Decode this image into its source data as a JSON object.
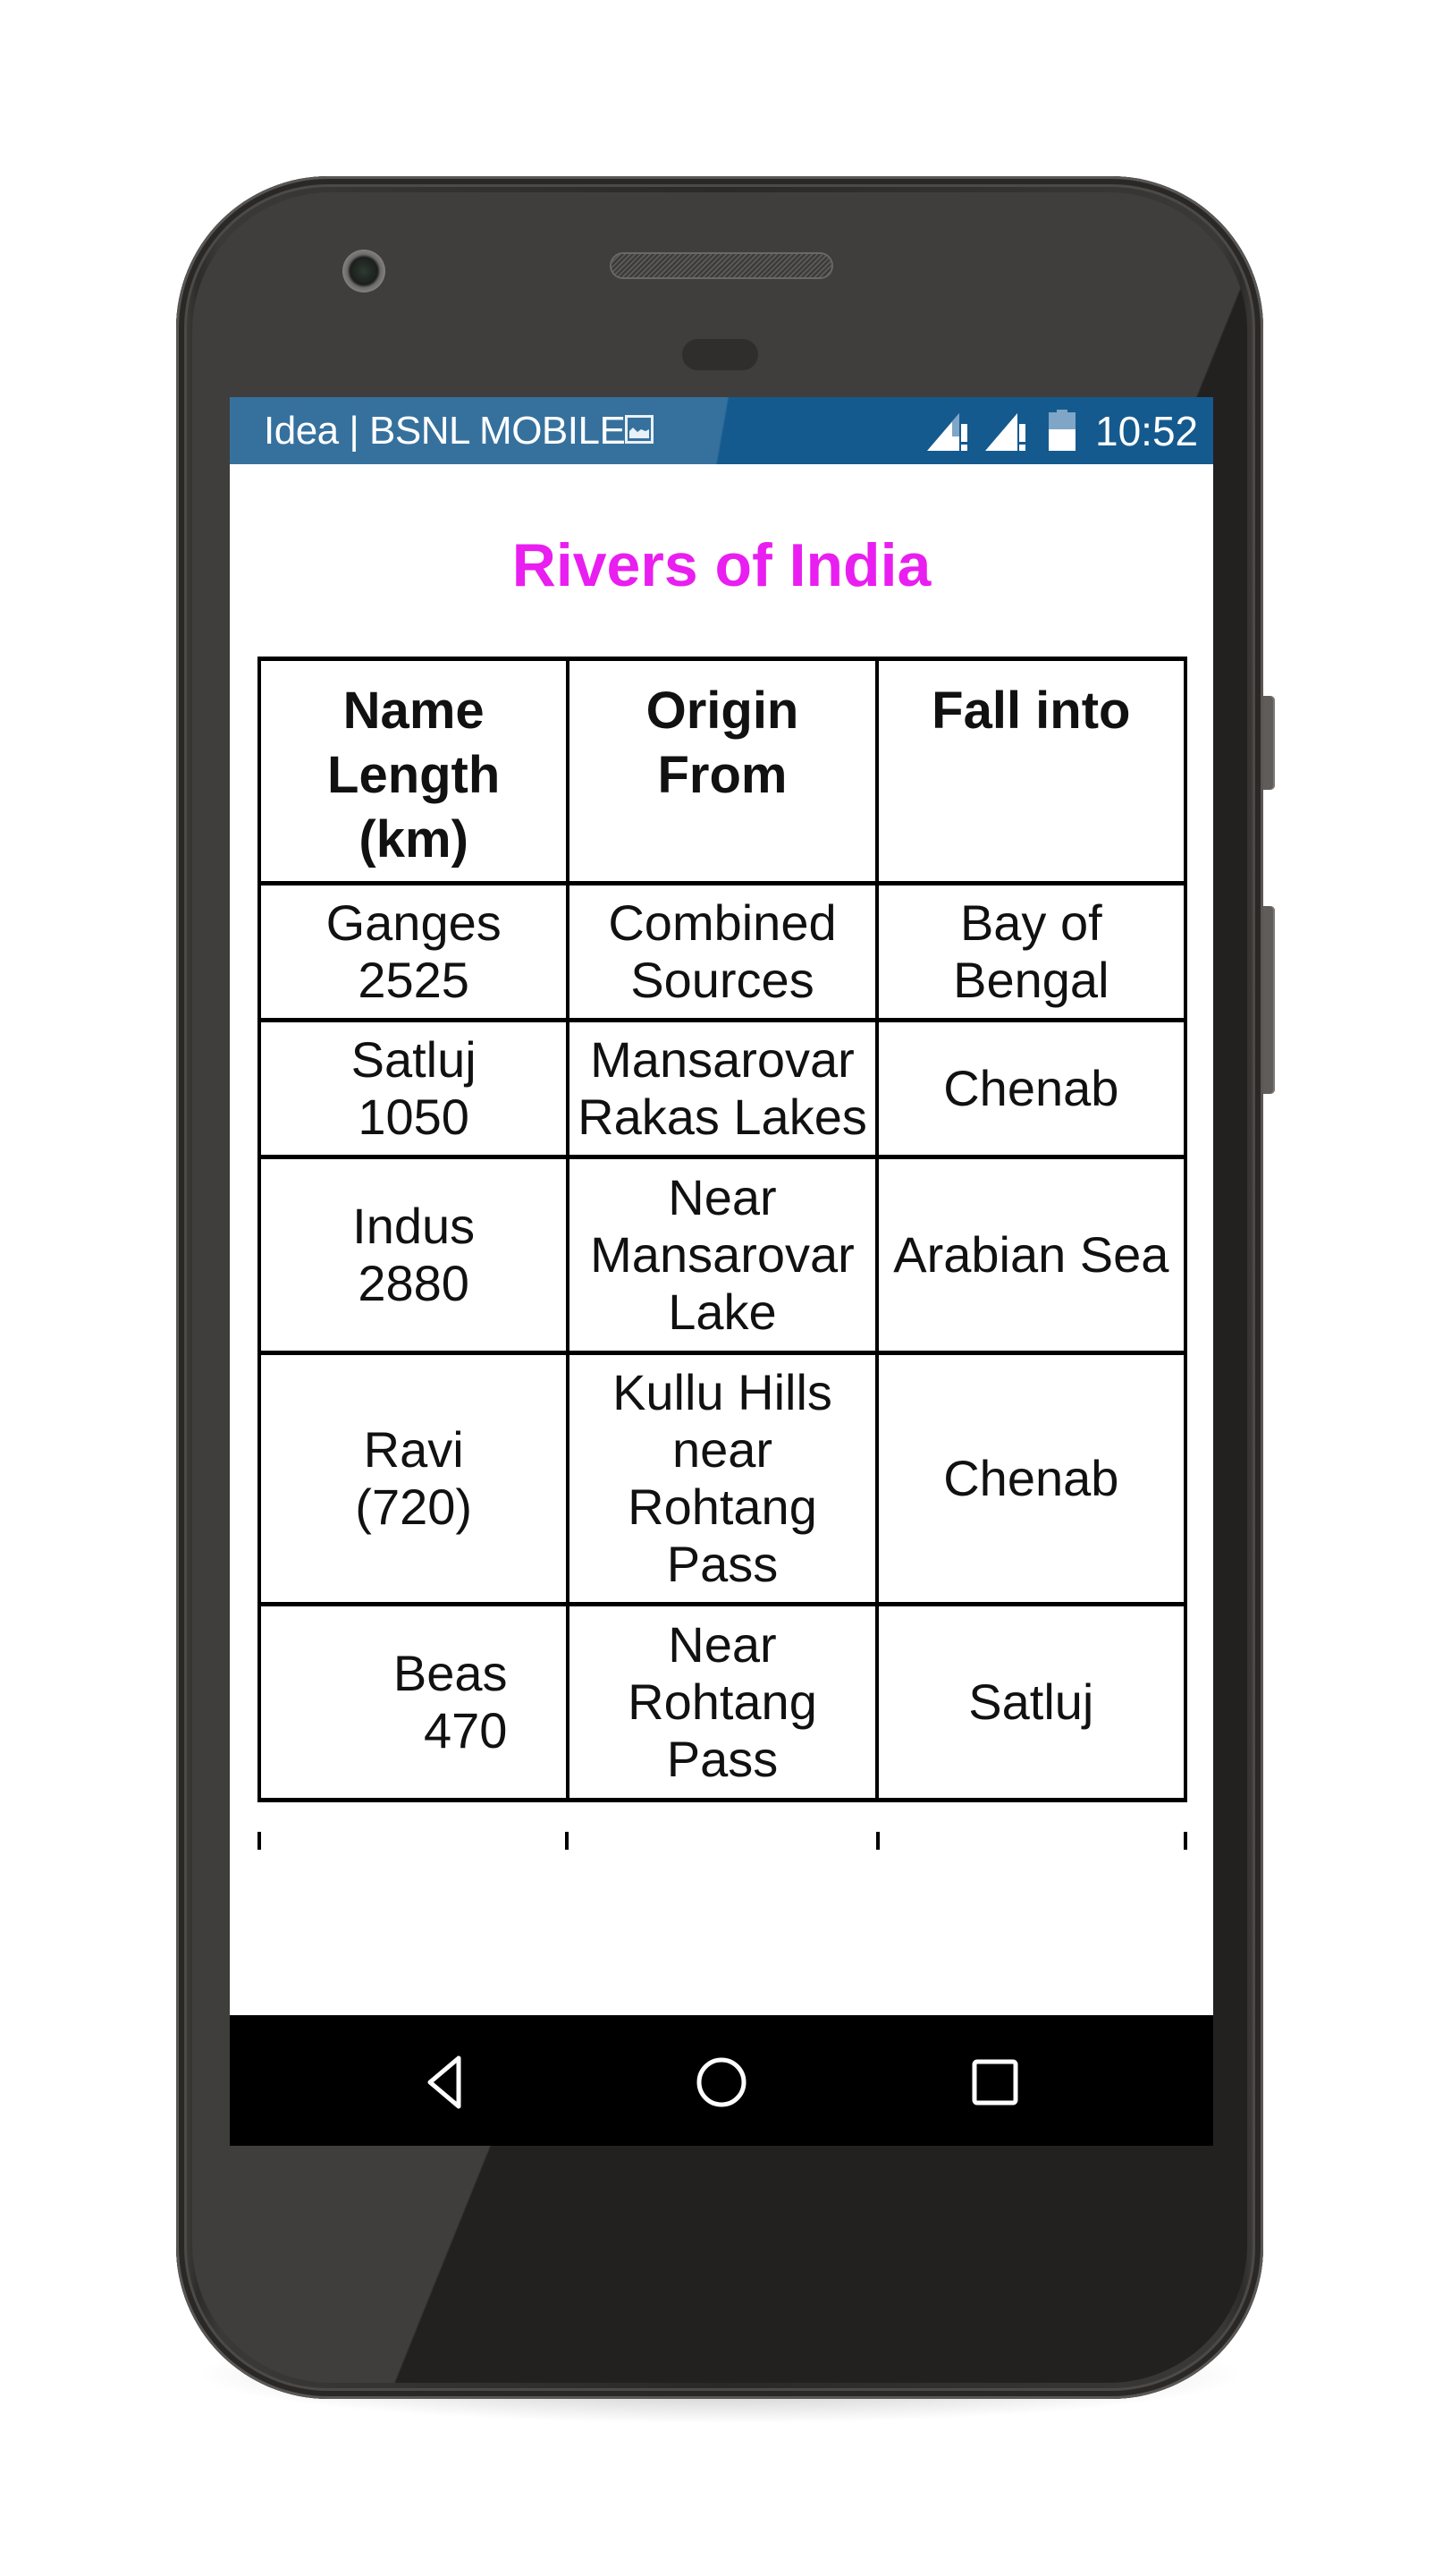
{
  "device": {
    "type": "android-phone"
  },
  "status_bar": {
    "carrier": "Idea | BSNL MOBILE",
    "notification_icon": "image-icon",
    "signal_icons": [
      "signal-no-data-icon",
      "signal-no-data-icon"
    ],
    "battery_icon": "battery-icon",
    "battery_level_fraction": 0.55,
    "time": "10:52",
    "background_color": "#155a8e"
  },
  "app": {
    "title": "Rivers of India",
    "title_color": "#e91ef0"
  },
  "table": {
    "headers": [
      [
        "Name",
        "Length",
        "(km)"
      ],
      [
        "Origin",
        "From"
      ],
      [
        "Fall into"
      ]
    ],
    "rows": [
      {
        "name_length": [
          "Ganges",
          "2525"
        ],
        "origin": [
          "Combined",
          "Sources"
        ],
        "falls_into": [
          "Bay of",
          "Bengal"
        ]
      },
      {
        "name_length": [
          "Satluj",
          "1050"
        ],
        "origin": [
          "Mansarovar",
          "Rakas Lakes"
        ],
        "falls_into": [
          "Chenab"
        ]
      },
      {
        "name_length": [
          "Indus",
          "2880"
        ],
        "origin": [
          "Near",
          "Mansarovar",
          "Lake"
        ],
        "falls_into": [
          "Arabian Sea"
        ]
      },
      {
        "name_length": [
          "Ravi",
          "(720)"
        ],
        "origin": [
          "Kullu Hills",
          "near",
          "Rohtang",
          "Pass"
        ],
        "falls_into": [
          "Chenab"
        ]
      },
      {
        "name_length": [
          "Beas",
          "470"
        ],
        "origin": [
          "Near",
          "Rohtang",
          "Pass"
        ],
        "falls_into": [
          "Satluj"
        ]
      }
    ]
  },
  "nav_bar": {
    "buttons": [
      {
        "name": "back",
        "icon": "back-triangle-icon"
      },
      {
        "name": "home",
        "icon": "home-circle-icon"
      },
      {
        "name": "recents",
        "icon": "recents-square-icon"
      }
    ]
  }
}
